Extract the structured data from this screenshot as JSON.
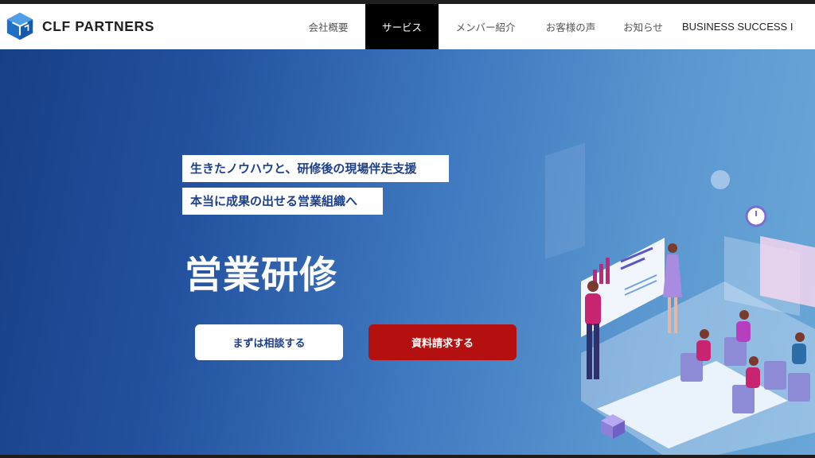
{
  "brand": {
    "name": "CLF PARTNERS"
  },
  "nav": {
    "items": [
      {
        "label": "会社概要",
        "active": false
      },
      {
        "label": "サービス",
        "active": true
      },
      {
        "label": "メンバー紹介",
        "active": false
      },
      {
        "label": "お客様の声",
        "active": false
      },
      {
        "label": "お知らせ",
        "active": false
      },
      {
        "label": "BUSINESS SUCCESS I",
        "active": false
      }
    ]
  },
  "hero": {
    "tagline_1": "生きたノウハウと、研修後の現場伴走支援",
    "tagline_2": "本当に成果の出せる営業組織へ",
    "title": "営業研修",
    "consult_button": "まずは相談する",
    "docs_button": "資料請求する"
  },
  "colors": {
    "brand_blue": "#1f6fc5",
    "cta_red": "#b3100f",
    "nav_active_bg": "#000000",
    "hero_gradient_start": "#173f86",
    "hero_gradient_end": "#6aa7d8"
  },
  "icons": [
    "clf-cube-logo-icon",
    "seminar-illustration"
  ]
}
